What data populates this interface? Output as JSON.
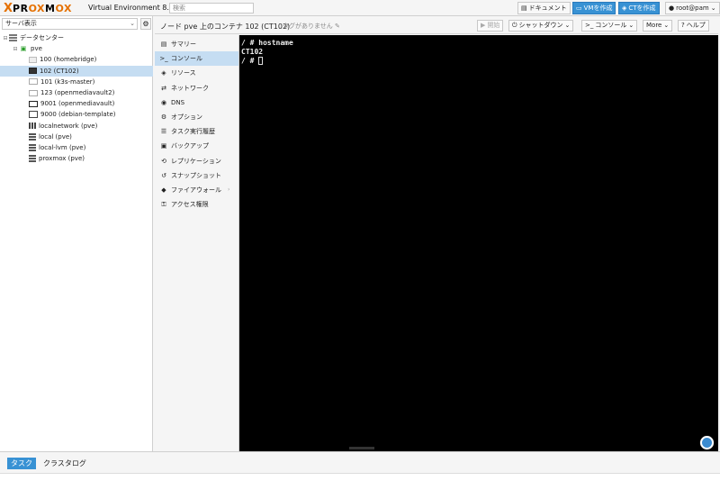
{
  "brand": {
    "logo_x": "X",
    "logo_text_a": "PR",
    "logo_text_ox": "OX",
    "logo_text_m": "M",
    "logo_text_ox2": "OX",
    "version": "Virtual Environment 8.2.2"
  },
  "search": {
    "placeholder": "検索"
  },
  "topbar": {
    "docs_label": "ドキュメント",
    "create_vm_label": "VMを作成",
    "create_ct_label": "CTを作成",
    "user_label": "root@pam"
  },
  "sidebar": {
    "view_label": "サーバ表示",
    "tree": [
      {
        "label": "データセンター",
        "icon": "datacenter-icon",
        "indent": 0,
        "toggle": "⊟"
      },
      {
        "label": "pve",
        "icon": "node-icon",
        "indent": 1,
        "toggle": "⊟"
      },
      {
        "label": "100 (homebridge)",
        "icon": "container-stopped-icon",
        "indent": 2
      },
      {
        "label": "102 (CT102)",
        "icon": "container-running-icon",
        "indent": 2,
        "selected": true
      },
      {
        "label": "101 (k3s-master)",
        "icon": "vm-stopped-icon",
        "indent": 2
      },
      {
        "label": "123 (openmediavault2)",
        "icon": "vm-stopped-icon",
        "indent": 2
      },
      {
        "label": "9001 (openmediavault)",
        "icon": "vm-running-icon",
        "indent": 2
      },
      {
        "label": "9000 (debian-template)",
        "icon": "template-icon",
        "indent": 2
      },
      {
        "label": "localnetwork (pve)",
        "icon": "network-icon",
        "indent": 2
      },
      {
        "label": "local (pve)",
        "icon": "storage-icon",
        "indent": 2
      },
      {
        "label": "local-lvm (pve)",
        "icon": "storage-icon",
        "indent": 2
      },
      {
        "label": "proxmox (pve)",
        "icon": "storage-icon",
        "indent": 2
      }
    ]
  },
  "content_header": {
    "title": "ノード pve 上のコンテナ 102 (CT102)",
    "tags_label": "タグがありません",
    "start_label": "開始",
    "shutdown_label": "シャットダウン",
    "console_label": "コンソール",
    "more_label": "More",
    "help_label": "ヘルプ"
  },
  "menu": {
    "items": [
      {
        "label": "サマリー",
        "icon": "book-icon"
      },
      {
        "label": "コンソール",
        "icon": "terminal-icon",
        "selected": true
      },
      {
        "label": "リソース",
        "icon": "cube-icon"
      },
      {
        "label": "ネットワーク",
        "icon": "exchange-icon"
      },
      {
        "label": "DNS",
        "icon": "globe-icon"
      },
      {
        "label": "オプション",
        "icon": "gear-icon"
      },
      {
        "label": "タスク実行履歴",
        "icon": "list-icon"
      },
      {
        "label": "バックアップ",
        "icon": "floppy-icon"
      },
      {
        "label": "レプリケーション",
        "icon": "retweet-icon"
      },
      {
        "label": "スナップショット",
        "icon": "history-icon"
      },
      {
        "label": "ファイアウォール",
        "icon": "shield-icon",
        "arrow": "›"
      },
      {
        "label": "アクセス権限",
        "icon": "unlock-icon"
      }
    ]
  },
  "terminal": {
    "lines": [
      "/ # hostname",
      "CT102",
      "/ # "
    ]
  },
  "bottom": {
    "tab_tasks": "タスク",
    "tab_cluster_log": "クラスタログ"
  },
  "colors": {
    "accent": "#3892d4",
    "selection": "#c5ddf2",
    "logo_orange": "#e57000"
  }
}
